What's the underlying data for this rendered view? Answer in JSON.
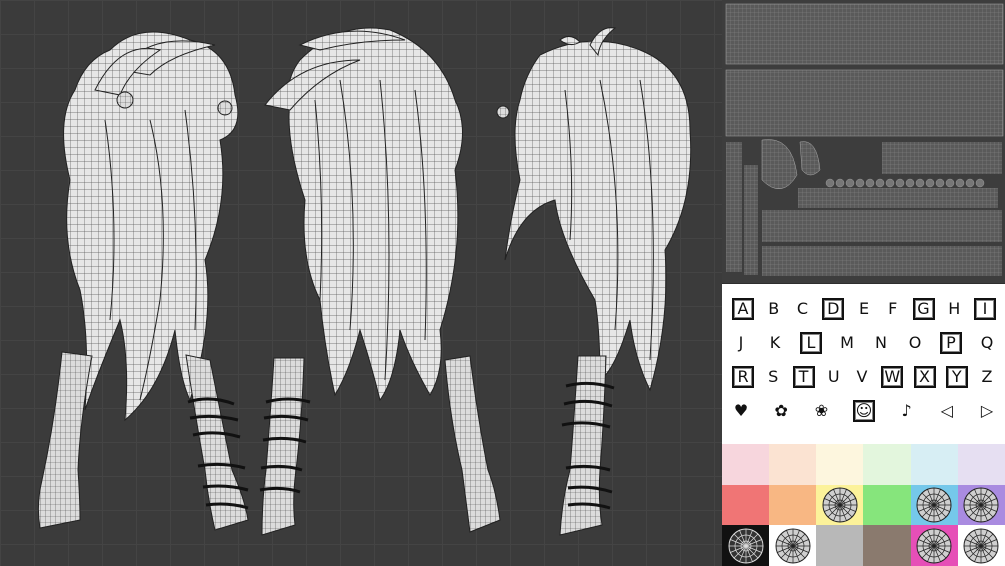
{
  "atlas": {
    "rows": [
      [
        "A",
        "B",
        "C",
        "D",
        "E",
        "F",
        "G",
        "H",
        "I"
      ],
      [
        "J",
        "K",
        "L",
        "M",
        "N",
        "O",
        "P",
        "Q"
      ],
      [
        "R",
        "S",
        "T",
        "U",
        "V",
        "W",
        "X",
        "Y",
        "Z"
      ],
      [
        "♥",
        "✿",
        "❀",
        "☺",
        "♪",
        "◁",
        "▷"
      ]
    ],
    "boxed": [
      "A",
      "D",
      "G",
      "I",
      "L",
      "P",
      "R",
      "T",
      "W",
      "X",
      "Y",
      "☺"
    ]
  },
  "swatch_colors": [
    "#f7d6dd",
    "#fbe3d2",
    "#fdf6de",
    "#e3f6dd",
    "#d7eef4",
    "#e6dff2",
    "#f07575",
    "#f8b783",
    "#fcf29a",
    "#86e57c",
    "#75c8ea",
    "#a98be0",
    "#111111",
    "#ffffff",
    "#b8b8b8",
    "#8a7a6e",
    "#e64fb7",
    "#ffffff"
  ]
}
